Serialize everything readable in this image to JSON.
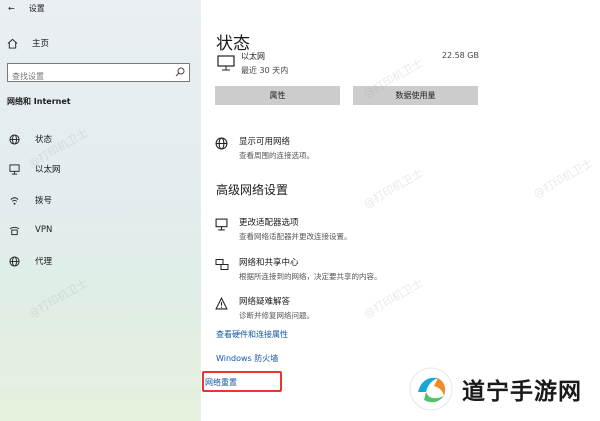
{
  "window": {
    "title": "设置"
  },
  "sidebar": {
    "home_label": "主页",
    "search_placeholder": "查找设置",
    "section_title": "网络和 Internet",
    "items": [
      {
        "label": "状态",
        "icon": "globe-icon"
      },
      {
        "label": "以太网",
        "icon": "ethernet-icon"
      },
      {
        "label": "拨号",
        "icon": "dialup-icon"
      },
      {
        "label": "VPN",
        "icon": "vpn-icon"
      },
      {
        "label": "代理",
        "icon": "globe-icon"
      }
    ]
  },
  "main": {
    "title": "状态",
    "ethernet": {
      "name": "以太网",
      "subtitle": "最近 30 天内",
      "usage": "22.58 GB"
    },
    "buttons": {
      "properties": "属性",
      "data_usage": "数据使用量"
    },
    "show_networks": {
      "title": "显示可用网络",
      "desc": "查看周围的连接选项。"
    },
    "advanced_title": "高级网络设置",
    "advanced_items": [
      {
        "title": "更改适配器选项",
        "desc": "查看网络适配器并更改连接设置。",
        "icon": "adapter-icon"
      },
      {
        "title": "网络和共享中心",
        "desc": "根据所连接到的网络，决定要共享的内容。",
        "icon": "sharing-center-icon"
      },
      {
        "title": "网络疑难解答",
        "desc": "诊断并修复网络问题。",
        "icon": "warning-icon"
      }
    ],
    "links": {
      "hardware": "查看硬件和连接属性",
      "firewall": "Windows 防火墙",
      "reset": "网络重置"
    }
  },
  "watermark": "@打印机卫士",
  "brand": {
    "name": "道宁手游网"
  },
  "colors": {
    "link": "#1257a6",
    "highlight": "#ee3333",
    "button": "#cccccc"
  }
}
